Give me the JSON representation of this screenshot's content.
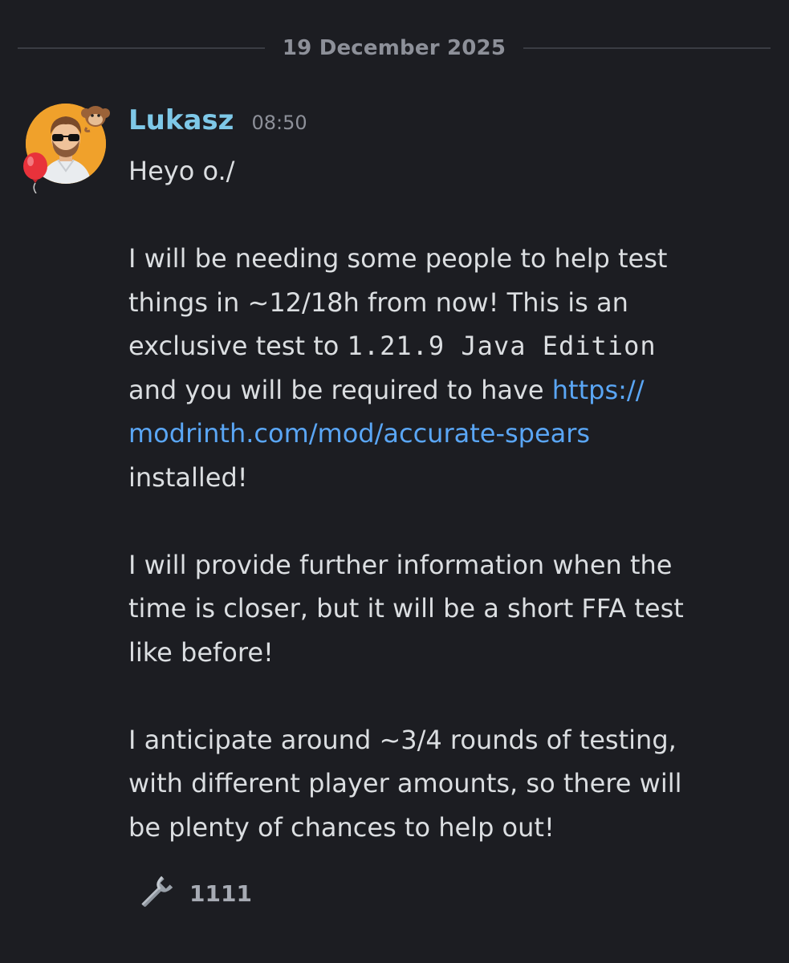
{
  "divider": {
    "date": "19 December 2025"
  },
  "message": {
    "author": "Lukasz",
    "time": "08:50",
    "greeting": "Heyo o./",
    "p1_line1": "I will be needing some people to help test",
    "p1_line2": "things in ~12/18h from now! This is an",
    "p1_line3_text": "exclusive test to ",
    "p1_line3_code": "1.21.9 Java Edition",
    "p1_line4_text": "and you will be required to have ",
    "p1_link_part1": "https://",
    "p1_link_part2": "modrinth.com/mod/accurate-spears",
    "p1_line6": "installed!",
    "p2_line1": "I will provide further information when the",
    "p2_line2": "time is closer, but it will be a short FFA test",
    "p2_line3": "like before!",
    "p3_line1": "I anticipate around ~3/4 rounds of testing,",
    "p3_line2": "with different player amounts, so there will",
    "p3_line3": "be plenty of chances to help out!"
  },
  "reaction": {
    "emoji": "wrench-icon",
    "count": "1111"
  },
  "colors": {
    "background": "#1c1d22",
    "username": "#7ec8e8",
    "link": "#5aa6f5",
    "text": "#dbdee1",
    "muted": "#8d9099"
  }
}
